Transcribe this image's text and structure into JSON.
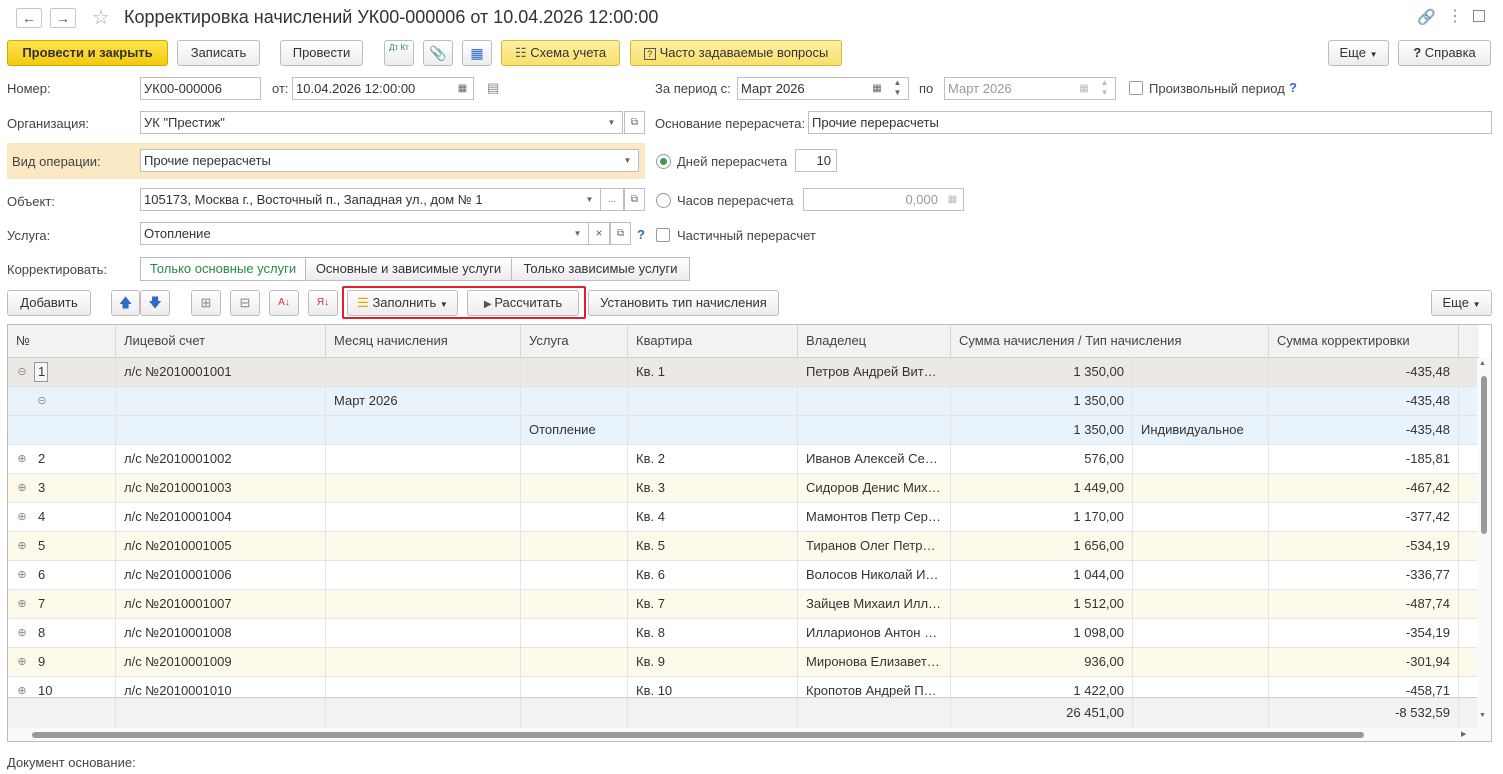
{
  "window": {
    "title": "Корректировка начислений УК00-000006 от 10.04.2026 12:00:00"
  },
  "toolbar": {
    "post_close": "Провести и закрыть",
    "write": "Записать",
    "post": "Провести",
    "dtkt_label": "Дт Кт",
    "scheme": "Схема учета",
    "faq": "Часто задаваемые вопросы",
    "more": "Еще",
    "help": "Справка"
  },
  "form": {
    "number_label": "Номер:",
    "number_value": "УК00-000006",
    "from_label": "от:",
    "date_value": "10.04.2026 12:00:00",
    "period_label": "За период с:",
    "period_from": "Март 2026",
    "to_label": "по",
    "period_to": "Март 2026",
    "arbitrary_period": "Произвольный период",
    "help_mark": "?",
    "org_label": "Организация:",
    "org_value": "УК \"Престиж\"",
    "basis_label": "Основание перерасчета:",
    "basis_value": "Прочие перерасчеты",
    "op_label": "Вид операции:",
    "op_value": "Прочие перерасчеты",
    "days_label": "Дней перерасчета",
    "days_value": "10",
    "object_label": "Объект:",
    "object_value": "105173, Москва г., Восточный п., Западная ул., дом № 1",
    "hours_label": "Часов перерасчета",
    "hours_value": "0,000",
    "service_label": "Услуга:",
    "service_value": "Отопление",
    "partial_label": "Частичный перерасчет",
    "correct_label": "Корректировать:",
    "correct_options": [
      "Только основные услуги",
      "Основные и зависимые услуги",
      "Только зависимые услуги"
    ],
    "doc_basis_label": "Документ основание:"
  },
  "table_toolbar": {
    "add": "Добавить",
    "fill": "Заполнить",
    "calculate": "Рассчитать",
    "set_type": "Установить тип начисления",
    "more": "Еще"
  },
  "table": {
    "columns": [
      "№",
      "Лицевой счет",
      "Месяц начисления",
      "Услуга",
      "Квартира",
      "Владелец",
      "Сумма начисления / Тип начисления",
      "Сумма корректировки"
    ],
    "rows": [
      {
        "num": "1",
        "account": "л/с №2010001001",
        "month": "",
        "service": "",
        "flat": "Кв. 1",
        "owner": "Петров Андрей Вита…",
        "sum": "1 350,00",
        "type": "",
        "corr": "-435,48"
      },
      {
        "num": "",
        "account": "",
        "month": "Март 2026",
        "service": "",
        "flat": "",
        "owner": "",
        "sum": "1 350,00",
        "type": "",
        "corr": "-435,48"
      },
      {
        "num": "",
        "account": "",
        "month": "",
        "service": "Отопление",
        "flat": "",
        "owner": "",
        "sum": "1 350,00",
        "type": "Индивидуальное",
        "corr": "-435,48"
      },
      {
        "num": "2",
        "account": "л/с №2010001002",
        "month": "",
        "service": "",
        "flat": "Кв. 2",
        "owner": "Иванов Алексей Се…",
        "sum": "576,00",
        "type": "",
        "corr": "-185,81"
      },
      {
        "num": "3",
        "account": "л/с №2010001003",
        "month": "",
        "service": "",
        "flat": "Кв. 3",
        "owner": "Сидоров Денис Мих…",
        "sum": "1 449,00",
        "type": "",
        "corr": "-467,42"
      },
      {
        "num": "4",
        "account": "л/с №2010001004",
        "month": "",
        "service": "",
        "flat": "Кв. 4",
        "owner": "Мамонтов Петр Сер…",
        "sum": "1 170,00",
        "type": "",
        "corr": "-377,42"
      },
      {
        "num": "5",
        "account": "л/с №2010001005",
        "month": "",
        "service": "",
        "flat": "Кв. 5",
        "owner": "Тиранов Олег Петро…",
        "sum": "1 656,00",
        "type": "",
        "corr": "-534,19"
      },
      {
        "num": "6",
        "account": "л/с №2010001006",
        "month": "",
        "service": "",
        "flat": "Кв. 6",
        "owner": "Волосов Николай И…",
        "sum": "1 044,00",
        "type": "",
        "corr": "-336,77"
      },
      {
        "num": "7",
        "account": "л/с №2010001007",
        "month": "",
        "service": "",
        "flat": "Кв. 7",
        "owner": "Зайцев Михаил Илл…",
        "sum": "1 512,00",
        "type": "",
        "corr": "-487,74"
      },
      {
        "num": "8",
        "account": "л/с №2010001008",
        "month": "",
        "service": "",
        "flat": "Кв. 8",
        "owner": "Илларионов Антон …",
        "sum": "1 098,00",
        "type": "",
        "corr": "-354,19"
      },
      {
        "num": "9",
        "account": "л/с №2010001009",
        "month": "",
        "service": "",
        "flat": "Кв. 9",
        "owner": "Миронова Елизавет…",
        "sum": "936,00",
        "type": "",
        "corr": "-301,94"
      },
      {
        "num": "10",
        "account": "л/с №2010001010",
        "month": "",
        "service": "",
        "flat": "Кв. 10",
        "owner": "Кропотов Андрей П…",
        "sum": "1 422,00",
        "type": "",
        "corr": "-458,71"
      }
    ],
    "total_sum": "26 451,00",
    "total_corr": "-8 532,59"
  },
  "colors": {
    "accent_yellow": "#f3c90e",
    "highlight_red": "#e0202a",
    "selected_row": "#e9f3fc",
    "alt_row": "#fdfaec"
  }
}
